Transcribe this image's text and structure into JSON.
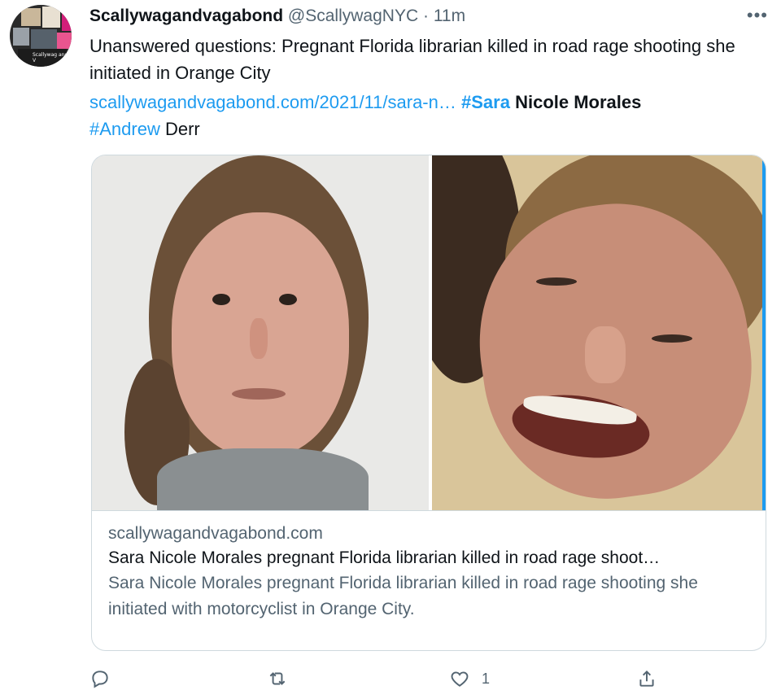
{
  "author": {
    "name": "Scallywagandvagabond",
    "handle": "@ScallywagNYC",
    "separator": "·",
    "time": "11m",
    "avatar_caption": "Scallywag and V"
  },
  "more_menu": "•••",
  "tweet": {
    "line1": "Unanswered questions: Pregnant Florida librarian killed in road rage shooting she initiated in Orange City",
    "link": "scallywagandvagabond.com/2021/11/sara-n…",
    "tag1": "#Sara",
    "plain1": "Nicole Morales",
    "tag2": "#Andrew",
    "plain2": "Derr"
  },
  "card": {
    "domain": "scallywagandvagabond.com",
    "title": "Sara Nicole Morales pregnant Florida librarian killed in road rage shoot…",
    "description": "Sara Nicole Morales pregnant Florida librarian killed in road rage shooting she initiated with motorcyclist in Orange City."
  },
  "actions": {
    "reply_icon": "reply-icon",
    "retweet_icon": "retweet-icon",
    "like_icon": "heart-icon",
    "like_count": "1",
    "share_icon": "share-icon"
  }
}
